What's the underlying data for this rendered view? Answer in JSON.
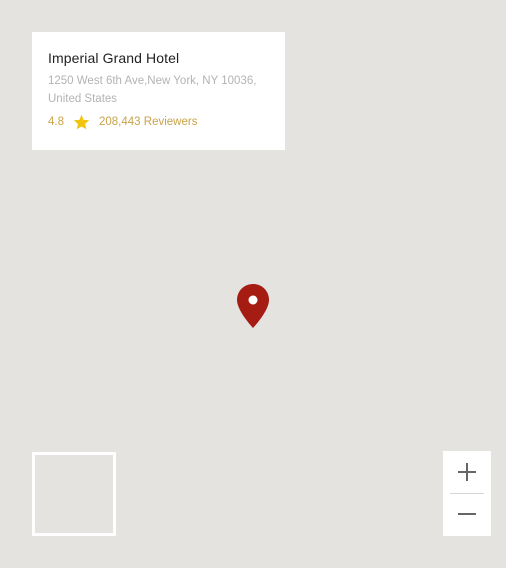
{
  "card": {
    "title": "Imperial Grand Hotel",
    "address": "1250 West 6th Ave,New York, NY 10036, United States",
    "rating": "4.8",
    "reviewers": "208,443 Reviewers"
  },
  "icons": {
    "star": "star-icon",
    "marker": "map-marker-icon",
    "zoom_in": "plus-icon",
    "zoom_out": "minus-icon"
  },
  "colors": {
    "map_background": "#e5e3df",
    "marker": "#a51c12",
    "rating_accent": "#c9a24a",
    "star": "#f1c40f"
  }
}
